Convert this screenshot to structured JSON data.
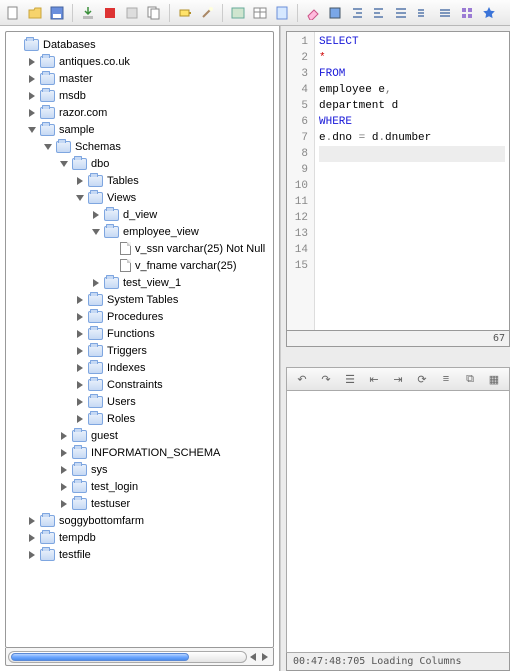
{
  "toolbar_icons": [
    "new",
    "open",
    "save",
    "sep",
    "import",
    "stop-red",
    "stop-gray",
    "copy",
    "sep",
    "battery",
    "wand",
    "sep",
    "run",
    "table",
    "script",
    "sep",
    "eraser",
    "book",
    "indent-left",
    "indent-right",
    "align-left",
    "bars1",
    "bars2",
    "grid",
    "star"
  ],
  "tree": {
    "root": "Databases",
    "items": [
      {
        "label": "antiques.co.uk",
        "state": "closed",
        "depth": 1
      },
      {
        "label": "master",
        "state": "closed",
        "depth": 1
      },
      {
        "label": "msdb",
        "state": "closed",
        "depth": 1
      },
      {
        "label": "razor.com",
        "state": "closed",
        "depth": 1
      },
      {
        "label": "sample",
        "state": "open",
        "depth": 1,
        "children": [
          {
            "label": "Schemas",
            "state": "open",
            "depth": 2,
            "children": [
              {
                "label": "dbo",
                "state": "open",
                "depth": 3,
                "children": [
                  {
                    "label": "Tables",
                    "state": "closed",
                    "depth": 4
                  },
                  {
                    "label": "Views",
                    "state": "open",
                    "depth": 4,
                    "children": [
                      {
                        "label": "d_view",
                        "state": "closed",
                        "depth": 5
                      },
                      {
                        "label": "employee_view",
                        "state": "open",
                        "depth": 5,
                        "children": [
                          {
                            "label": "v_ssn varchar(25) Not Null",
                            "kind": "file",
                            "depth": 6
                          },
                          {
                            "label": "v_fname varchar(25)",
                            "kind": "file",
                            "depth": 6
                          }
                        ]
                      },
                      {
                        "label": "test_view_1",
                        "state": "closed",
                        "depth": 5
                      }
                    ]
                  },
                  {
                    "label": "System Tables",
                    "state": "closed",
                    "depth": 4
                  },
                  {
                    "label": "Procedures",
                    "state": "closed",
                    "depth": 4
                  },
                  {
                    "label": "Functions",
                    "state": "closed",
                    "depth": 4
                  },
                  {
                    "label": "Triggers",
                    "state": "closed",
                    "depth": 4
                  },
                  {
                    "label": "Indexes",
                    "state": "closed",
                    "depth": 4
                  },
                  {
                    "label": "Constraints",
                    "state": "closed",
                    "depth": 4
                  },
                  {
                    "label": "Users",
                    "state": "closed",
                    "depth": 4
                  },
                  {
                    "label": "Roles",
                    "state": "closed",
                    "depth": 4
                  }
                ]
              },
              {
                "label": "guest",
                "state": "closed",
                "depth": 3
              },
              {
                "label": "INFORMATION_SCHEMA",
                "state": "closed",
                "depth": 3
              },
              {
                "label": "sys",
                "state": "closed",
                "depth": 3
              },
              {
                "label": "test_login",
                "state": "closed",
                "depth": 3
              },
              {
                "label": "testuser",
                "state": "closed",
                "depth": 3
              }
            ]
          }
        ]
      },
      {
        "label": "soggybottomfarm",
        "state": "closed",
        "depth": 1
      },
      {
        "label": "tempdb",
        "state": "closed",
        "depth": 1
      },
      {
        "label": "testfile",
        "state": "closed",
        "depth": 1
      }
    ]
  },
  "sql": {
    "line_count": 15,
    "lines": [
      {
        "n": 1,
        "tokens": [
          {
            "t": "SELECT",
            "c": "kw"
          }
        ]
      },
      {
        "n": 2,
        "tokens": [
          {
            "t": "    ",
            "c": ""
          },
          {
            "t": "*",
            "c": "star"
          }
        ]
      },
      {
        "n": 3,
        "tokens": [
          {
            "t": "FROM",
            "c": "kw"
          }
        ]
      },
      {
        "n": 4,
        "tokens": [
          {
            "t": "    employee e",
            "c": ""
          },
          {
            "t": ",",
            "c": "op"
          }
        ]
      },
      {
        "n": 5,
        "tokens": [
          {
            "t": "    department d",
            "c": ""
          }
        ]
      },
      {
        "n": 6,
        "tokens": [
          {
            "t": "WHERE",
            "c": "kw"
          }
        ]
      },
      {
        "n": 7,
        "tokens": [
          {
            "t": "    e",
            "c": ""
          },
          {
            "t": ".",
            "c": "op"
          },
          {
            "t": "dno ",
            "c": ""
          },
          {
            "t": "=",
            "c": "op"
          },
          {
            "t": " d",
            "c": ""
          },
          {
            "t": ".",
            "c": "op"
          },
          {
            "t": "dnumber",
            "c": ""
          }
        ]
      },
      {
        "n": 8,
        "tokens": [],
        "caret": true
      }
    ],
    "col_indicator": "67"
  },
  "result_toolbar_icons": [
    "undo",
    "redo",
    "chat",
    "back",
    "next",
    "refresh",
    "rows",
    "copy",
    "table"
  ],
  "status_text": "00:47:48:705 Loading Columns"
}
